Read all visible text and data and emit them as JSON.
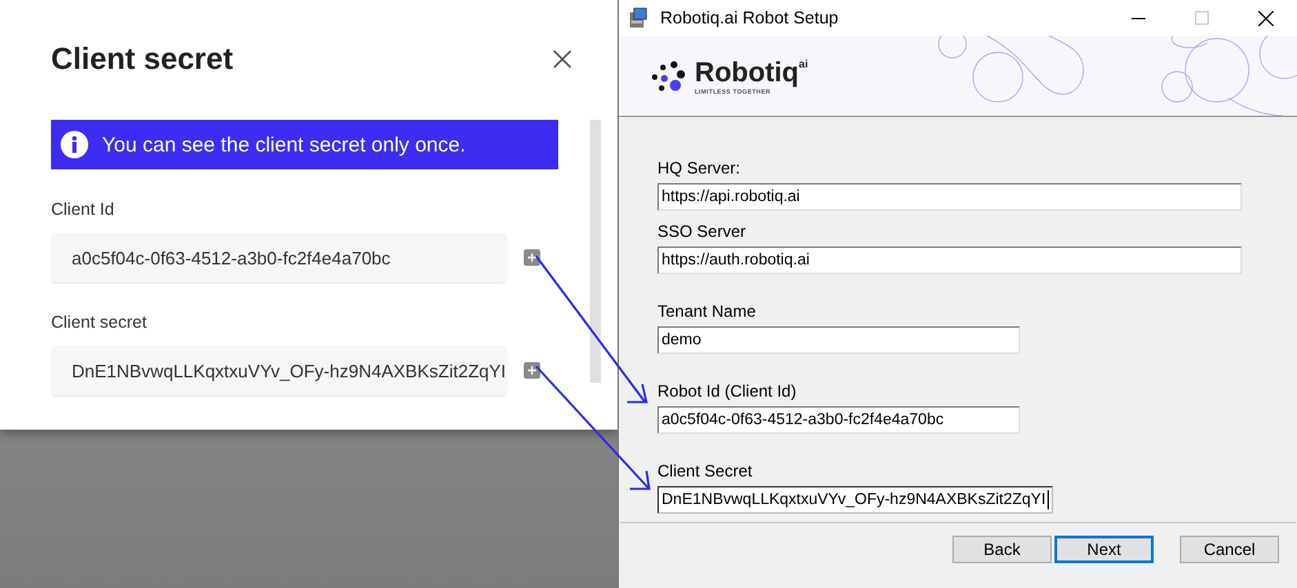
{
  "dialog": {
    "title": "Client secret",
    "notice": "You can see the client secret only once.",
    "fields": [
      {
        "label": "Client Id",
        "value": "a0c5f04c-0f63-4512-a3b0-fc2f4e4a70bc"
      },
      {
        "label": "Client secret",
        "value": "DnE1NBvwqLLKqxtxuVYv_OFy-hz9N4AXBKsZit2ZqYI"
      }
    ]
  },
  "window": {
    "title": "Robotiq.ai Robot Setup",
    "logo": {
      "name": "Robotiq",
      "suffix": "ai",
      "tagline": "LIMITLESS TOGETHER"
    },
    "fields": [
      {
        "label": "HQ Server:",
        "value": "https://api.robotiq.ai",
        "focused": false
      },
      {
        "label": "SSO Server",
        "value": "https://auth.robotiq.ai",
        "focused": false
      },
      {
        "label": "Tenant Name",
        "value": "demo",
        "focused": false
      },
      {
        "label": "Robot Id (Client Id)",
        "value": "a0c5f04c-0f63-4512-a3b0-fc2f4e4a70bc",
        "focused": false
      },
      {
        "label": "Client Secret",
        "value": "DnE1NBvwqLLKqxtxuVYv_OFy-hz9N4AXBKsZit2ZqYI",
        "focused": true
      }
    ],
    "buttons": [
      {
        "label": "Back",
        "default": false
      },
      {
        "label": "Next",
        "default": true
      },
      {
        "label": "Cancel",
        "default": false
      }
    ]
  }
}
